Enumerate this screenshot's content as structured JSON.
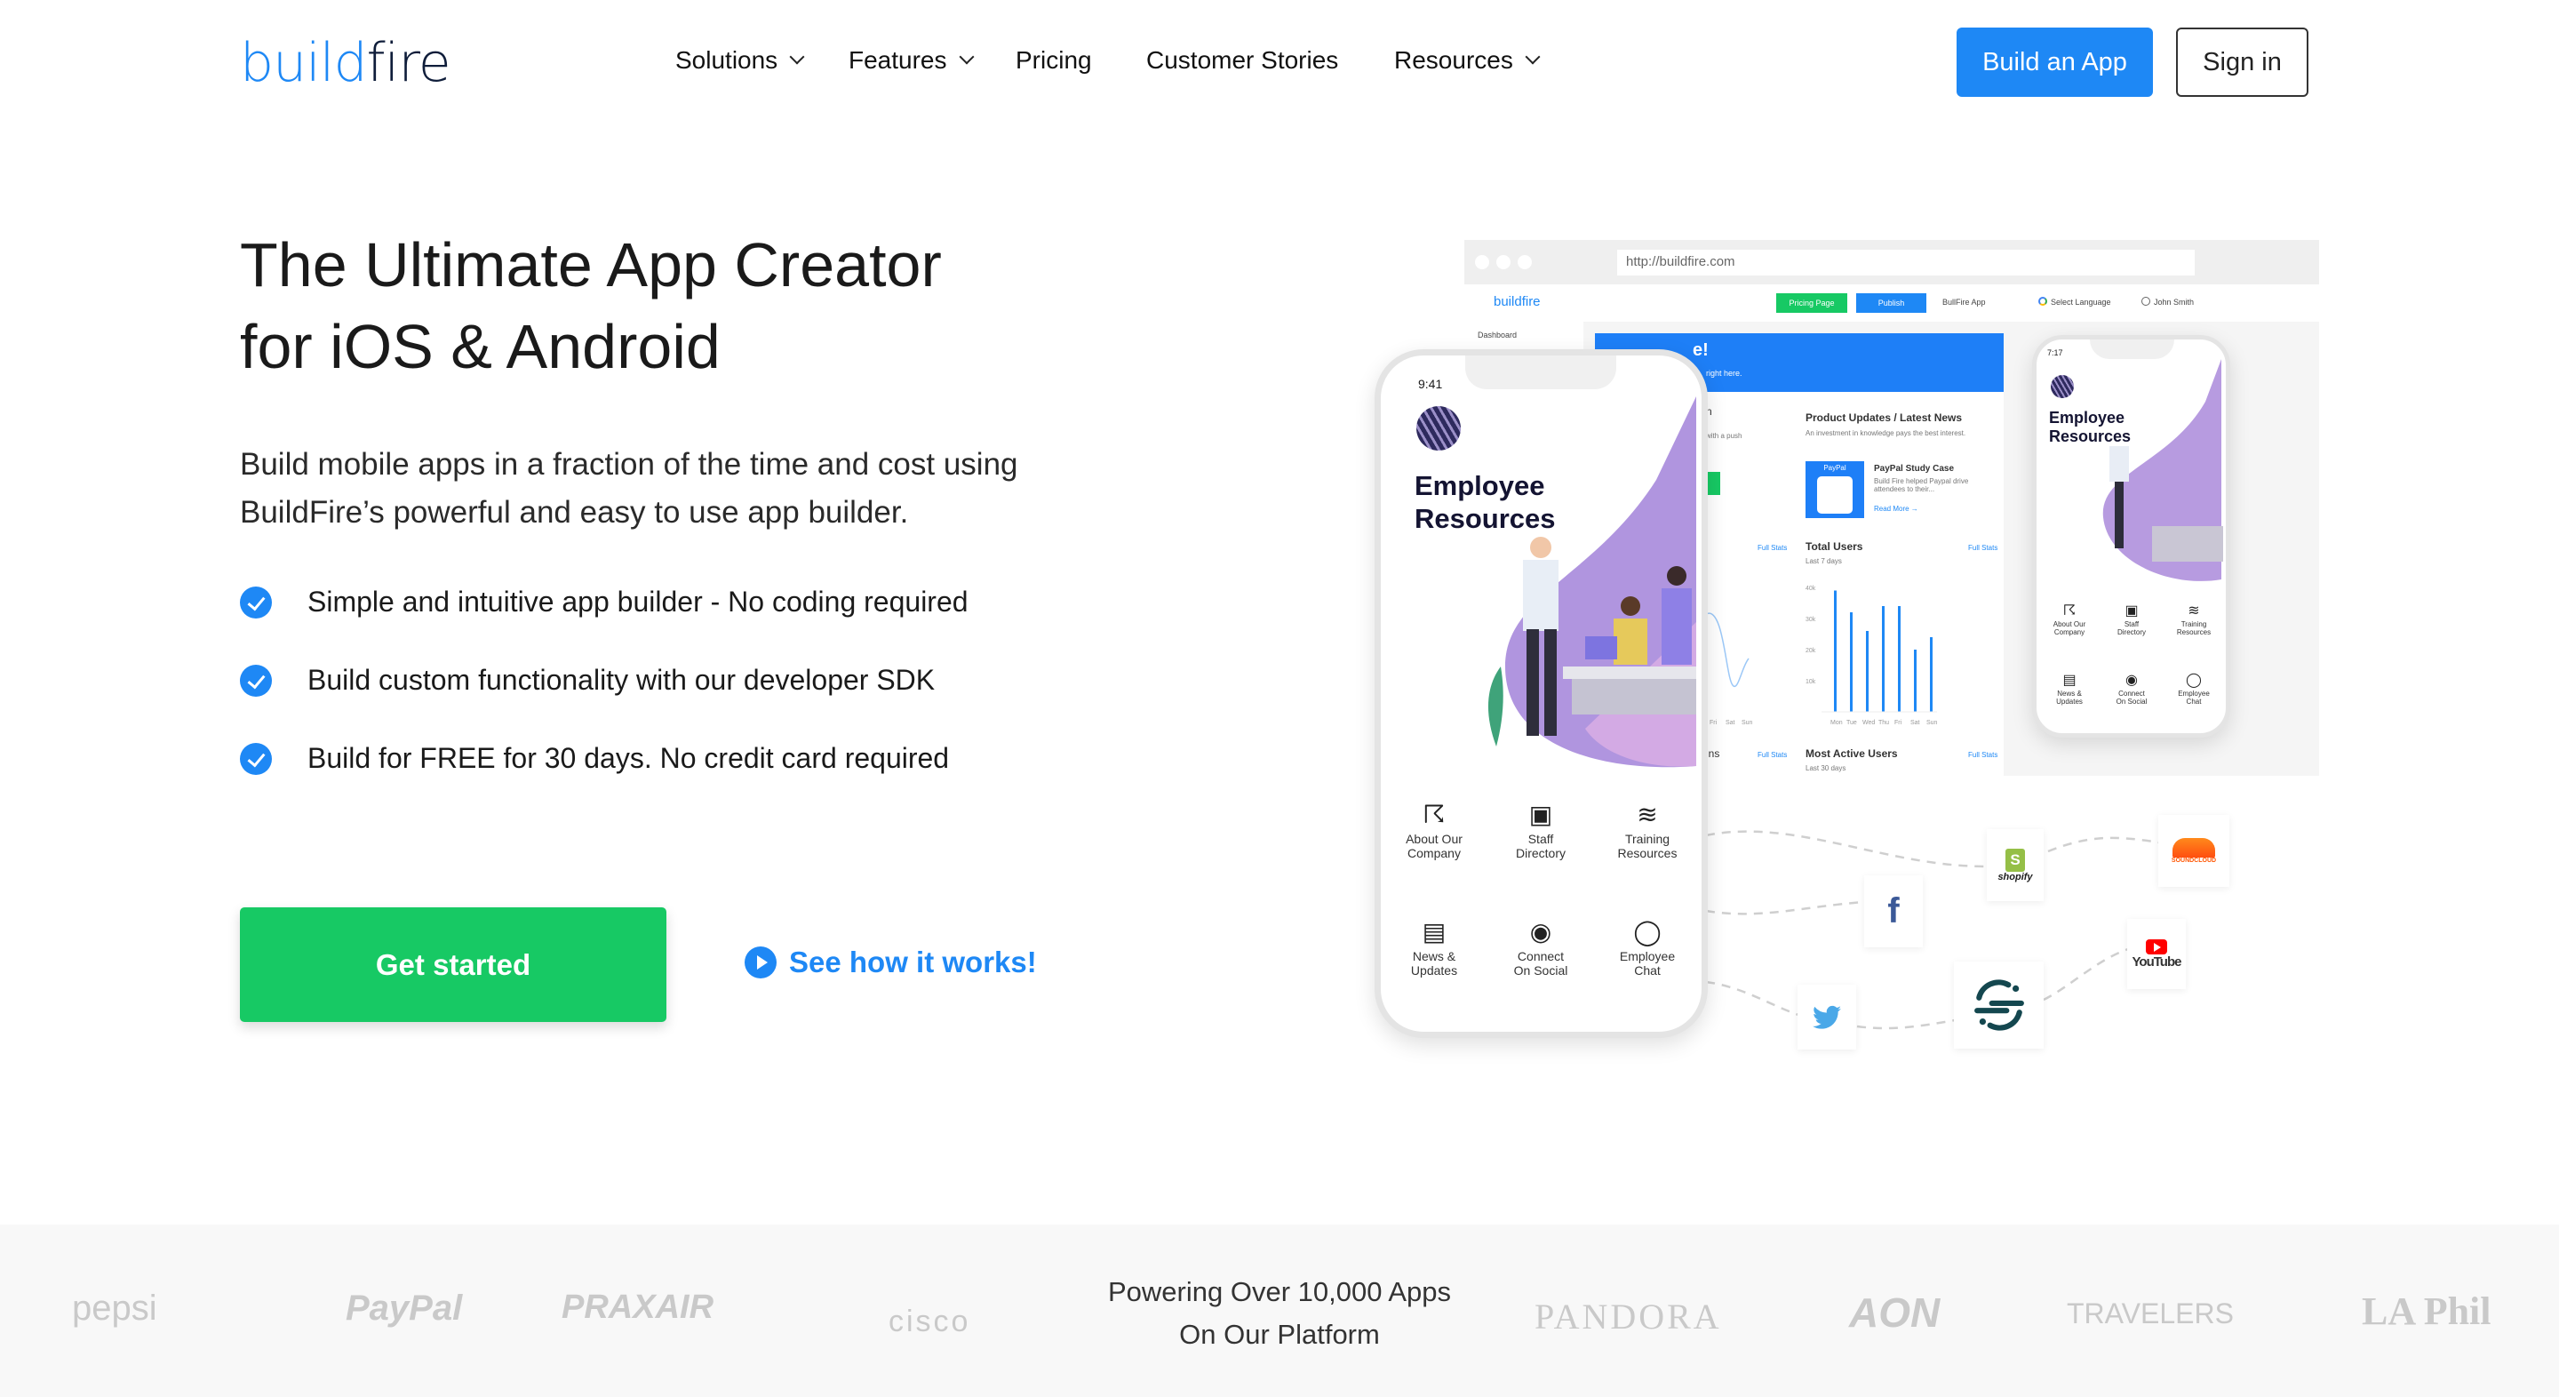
{
  "header": {
    "logo_part1": "build",
    "logo_part2": "fire",
    "nav": [
      {
        "label": "Solutions",
        "has_dropdown": true
      },
      {
        "label": "Features",
        "has_dropdown": true
      },
      {
        "label": "Pricing",
        "has_dropdown": false
      },
      {
        "label": "Customer Stories",
        "has_dropdown": false
      },
      {
        "label": "Resources",
        "has_dropdown": true
      }
    ],
    "build_button": "Build an App",
    "signin_button": "Sign in"
  },
  "hero": {
    "title_line1": "The Ultimate App Creator",
    "title_line2": "for iOS & Android",
    "lead_line1": "Build mobile apps in a fraction of the time and cost using",
    "lead_line2": "BuildFire’s powerful and easy to use app builder.",
    "bullets": [
      "Simple and intuitive app builder - No coding required",
      "Build custom functionality with our developer SDK",
      "Build for FREE for 30 days. No credit card required"
    ],
    "cta_primary": "Get started",
    "cta_secondary": "See how it works!"
  },
  "mockup": {
    "url": "http://buildfire.com",
    "logo": "buildfire",
    "pricing_page": "Pricing Page",
    "publish": "Publish",
    "app_select": "BullFire App",
    "language": "Select Language",
    "user": "John Smith",
    "dashboard": "Dashboard",
    "banner_title": "e!",
    "banner_sub": "right here.",
    "left_frag_title": "n",
    "left_frag_sub": "with a push",
    "left_frag_bottom": "ins",
    "news_title": "Product Updates / Latest News",
    "news_desc": "An investment in knowledge pays the best interest.",
    "paypal_thumb": "PayPal",
    "case_title": "PayPal Study Case",
    "case_body": "Build Fire helped Paypal drive attendees to their...",
    "read_more": "Read More →",
    "full_stats": "Full Stats",
    "total_users": "Total Users",
    "last7": "Last 7 days",
    "y_ticks": [
      "40k",
      "30k",
      "20k",
      "10k"
    ],
    "days": [
      "Mon",
      "Tue",
      "Wed",
      "Thu",
      "Fri",
      "Sat",
      "Sun"
    ],
    "left_days": [
      "Fri",
      "Sat",
      "Sun"
    ],
    "bar_values_k": [
      39,
      32,
      26,
      34,
      34,
      20,
      24
    ],
    "most_active": "Most Active Users",
    "last30": "Last 30 days",
    "phone": {
      "time": "9:41",
      "title1": "Employee",
      "title2": "Resources",
      "items": [
        {
          "icon": "runner-icon",
          "l1": "About Our",
          "l2": "Company"
        },
        {
          "icon": "directory-icon",
          "l1": "Staff",
          "l2": "Directory"
        },
        {
          "icon": "layers-icon",
          "l1": "Training",
          "l2": "Resources"
        },
        {
          "icon": "news-icon",
          "l1": "News &",
          "l2": "Updates"
        },
        {
          "icon": "broadcast-icon",
          "l1": "Connect",
          "l2": "On Social"
        },
        {
          "icon": "chat-icon",
          "l1": "Employee",
          "l2": "Chat"
        }
      ]
    },
    "phone_small_time": "7:17",
    "integrations": {
      "shopify": "shopify",
      "soundcloud": "SOUNDCLOUD",
      "youtube": "YouTube"
    },
    "colors": {
      "accent": "#1e88f5",
      "green": "#17c964",
      "purple": "#a98bd6"
    }
  },
  "footer": {
    "line1": "Powering Over 10,000 Apps",
    "line2": "On Our Platform",
    "logos": [
      "pepsi",
      "PayPal",
      "PRAXAIR",
      "cisco",
      "PANDORA",
      "AON",
      "TRAVELERS",
      "LA Phil"
    ]
  }
}
